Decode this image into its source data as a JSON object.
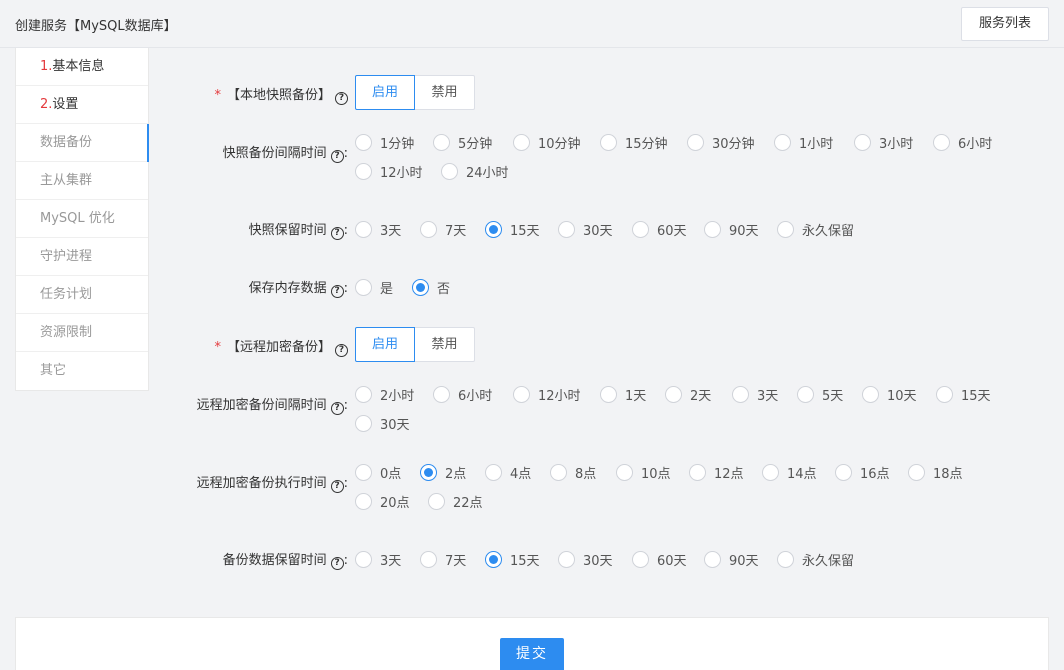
{
  "page_title": "创建服务【MySQL数据库】",
  "service_list_label": "服务列表",
  "sidebar": {
    "items": [
      {
        "num": "1.",
        "label": "基本信息"
      },
      {
        "num": "2.",
        "label": "设置"
      },
      {
        "num": "",
        "label": "数据备份"
      },
      {
        "num": "",
        "label": "主从集群"
      },
      {
        "num": "",
        "label": "MySQL 优化"
      },
      {
        "num": "",
        "label": "守护进程"
      },
      {
        "num": "",
        "label": "任务计划"
      },
      {
        "num": "",
        "label": "资源限制"
      },
      {
        "num": "",
        "label": "其它"
      }
    ]
  },
  "form": {
    "local_snapshot": {
      "label": "【本地快照备份】",
      "required": "*",
      "enable": "启用",
      "disable": "禁用",
      "selected": "启用"
    },
    "snapshot_interval": {
      "label": "快照备份间隔时间",
      "options": [
        "1分钟",
        "5分钟",
        "10分钟",
        "15分钟",
        "30分钟",
        "1小时",
        "3小时",
        "6小时",
        "12小时",
        "24小时"
      ],
      "selected": ""
    },
    "snapshot_retention": {
      "label": "快照保留时间",
      "options": [
        "3天",
        "7天",
        "15天",
        "30天",
        "60天",
        "90天",
        "永久保留"
      ],
      "selected": "15天"
    },
    "save_memory": {
      "label": "保存内存数据",
      "options": [
        "是",
        "否"
      ],
      "selected": "否"
    },
    "remote_backup": {
      "label": "【远程加密备份】",
      "required": "*",
      "enable": "启用",
      "disable": "禁用",
      "selected": "启用"
    },
    "remote_interval": {
      "label": "远程加密备份间隔时间",
      "options": [
        "2小时",
        "6小时",
        "12小时",
        "1天",
        "2天",
        "3天",
        "5天",
        "10天",
        "15天",
        "30天"
      ],
      "selected": ""
    },
    "remote_exec_time": {
      "label": "远程加密备份执行时间",
      "options": [
        "0点",
        "2点",
        "4点",
        "8点",
        "10点",
        "12点",
        "14点",
        "16点",
        "18点",
        "20点",
        "22点"
      ],
      "selected": "2点"
    },
    "backup_retention": {
      "label": "备份数据保留时间",
      "options": [
        "3天",
        "7天",
        "15天",
        "30天",
        "60天",
        "90天",
        "永久保留"
      ],
      "selected": "15天"
    }
  },
  "colon": ":",
  "submit_label": "提交"
}
